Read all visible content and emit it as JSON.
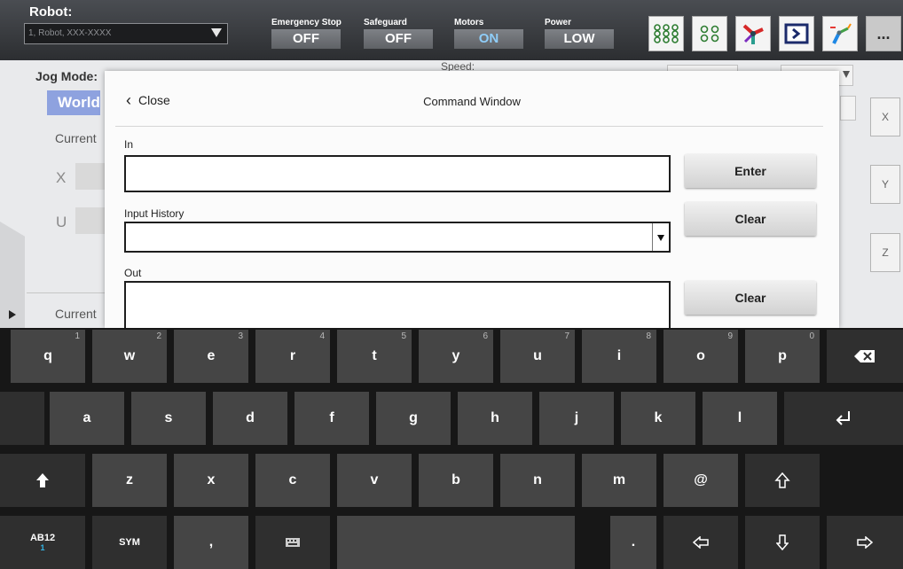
{
  "topbar": {
    "robot_label": "Robot:",
    "robot_value": "1, Robot, XXX-XXXX",
    "statuses": [
      {
        "caption": "Emergency Stop",
        "value": "OFF"
      },
      {
        "caption": "Safeguard",
        "value": "OFF"
      },
      {
        "caption": "Motors",
        "value": "ON"
      },
      {
        "caption": "Power",
        "value": "LOW"
      }
    ],
    "more_label": "..."
  },
  "background": {
    "jog_mode_label": "Jog Mode:",
    "speed_label": "Speed:",
    "world_button": "World",
    "current_label": "Current",
    "axis_x": "X",
    "axis_u": "U",
    "side_buttons": [
      "X",
      "Y",
      "Z"
    ]
  },
  "dialog": {
    "close_label": "Close",
    "title": "Command Window",
    "in_label": "In",
    "in_value": "",
    "history_label": "Input History",
    "out_label": "Out",
    "enter_button": "Enter",
    "clear_history_button": "Clear",
    "clear_out_button": "Clear"
  },
  "keyboard": {
    "row1": [
      {
        "label": "q",
        "hint": "1"
      },
      {
        "label": "w",
        "hint": "2"
      },
      {
        "label": "e",
        "hint": "3"
      },
      {
        "label": "r",
        "hint": "4"
      },
      {
        "label": "t",
        "hint": "5"
      },
      {
        "label": "y",
        "hint": "6"
      },
      {
        "label": "u",
        "hint": "7"
      },
      {
        "label": "i",
        "hint": "8"
      },
      {
        "label": "o",
        "hint": "9"
      },
      {
        "label": "p",
        "hint": "0"
      }
    ],
    "row2": [
      "a",
      "s",
      "d",
      "f",
      "g",
      "h",
      "j",
      "k",
      "l"
    ],
    "row3": [
      "z",
      "x",
      "c",
      "v",
      "b",
      "n",
      "m",
      "@"
    ],
    "ab12_label": "AB12",
    "ab12_sub": "1",
    "sym_label": "SYM",
    "comma": ",",
    "period": "."
  }
}
